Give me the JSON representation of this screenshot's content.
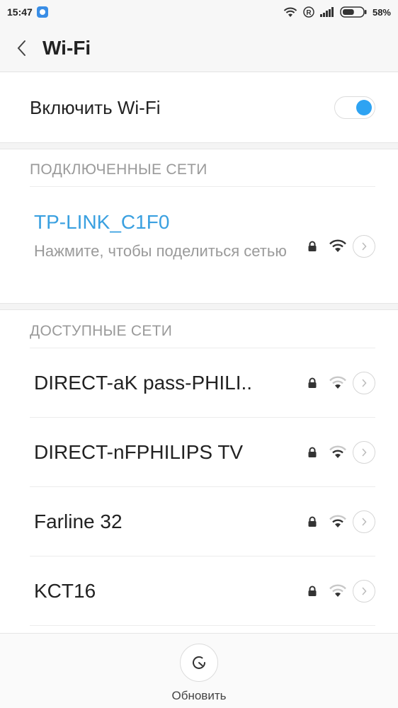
{
  "status_bar": {
    "time": "15:47",
    "battery_percent": "58%",
    "battery_level": 0.58,
    "icons": [
      "app-notification-icon",
      "wifi-icon",
      "roaming-r-icon",
      "cell-signal-icon",
      "battery-icon"
    ]
  },
  "header": {
    "title": "Wi-Fi",
    "back_icon": "chevron-left-icon"
  },
  "wifi_toggle": {
    "label": "Включить Wi-Fi",
    "enabled": true
  },
  "connected_section": {
    "title": "ПОДКЛЮЧЕННЫЕ СЕТИ",
    "network": {
      "ssid": "TP-LINK_C1F0",
      "subtitle": "Нажмите, чтобы поделиться сетью",
      "secured": true
    }
  },
  "available_section": {
    "title": "ДОСТУПНЫЕ СЕТИ",
    "networks": [
      {
        "ssid": "DIRECT-aK pass-PHILI..",
        "secured": true
      },
      {
        "ssid": "DIRECT-nFPHILIPS TV",
        "secured": true
      },
      {
        "ssid": "Farline 32",
        "secured": true
      },
      {
        "ssid": "KCT16",
        "secured": true
      }
    ]
  },
  "bottom_bar": {
    "refresh_label": "Обновить"
  },
  "colors": {
    "accent": "#2ea3f2",
    "connected_ssid": "#3aa0e0",
    "section_text": "#9a9a9a",
    "header_bg": "#f7f7f7"
  }
}
